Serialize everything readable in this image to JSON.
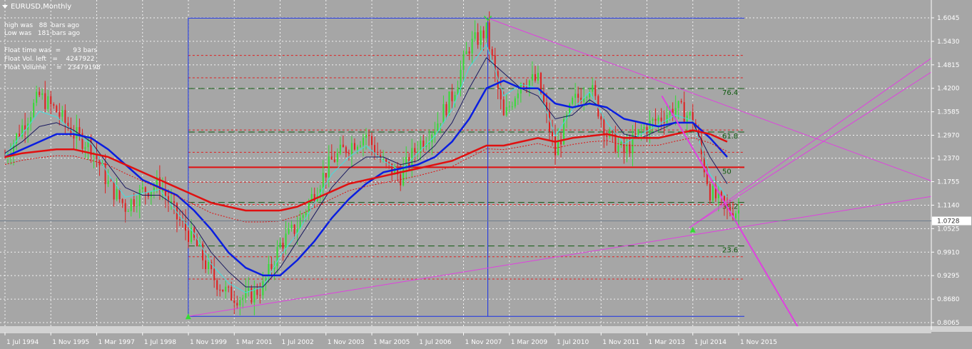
{
  "header": {
    "symbol": "EURUSD,Monthly",
    "info_lines": [
      "high was   88  bars ago",
      "Low was   181 bars ago",
      "",
      "Float time was  =      93 bars",
      "Float Vol. left   =    4247922",
      "Float Volume     =   23479198"
    ]
  },
  "price_axis": {
    "labels": [
      "1.6045",
      "1.5430",
      "1.4815",
      "1.4200",
      "1.3585",
      "1.2970",
      "1.2370",
      "1.1755",
      "1.1140",
      "1.0525",
      "0.9910",
      "0.9295",
      "0.8680",
      "0.8065"
    ],
    "current_price": "1.0728"
  },
  "time_axis": {
    "labels": [
      "1 Jul 1994",
      "1 Nov 1995",
      "1 Mar 1997",
      "1 Jul 1998",
      "1 Nov 1999",
      "1 Mar 2001",
      "1 Jul 2002",
      "1 Nov 2003",
      "1 Mar 2005",
      "1 Jul 2006",
      "1 Nov 2007",
      "1 Mar 2009",
      "1 Jul 2010",
      "1 Nov 2011",
      "1 Mar 2013",
      "1 Jul 2014",
      "1 Nov 2015"
    ]
  },
  "fib_labels": [
    "76.4",
    "61.8",
    "50",
    "38.2",
    "23.6"
  ],
  "colors": {
    "background": "#a6a6a6",
    "bull": "#33dd33",
    "bear": "#e02020",
    "ma_slow": "#e01010",
    "ma_mid": "#0a1ee0",
    "ma_fast": "#1a1a60",
    "ma_cyan": "#40e0e0",
    "fib": "#0f5a0f",
    "box": "#1a32e6",
    "trend": "#e040e0",
    "grid": "#f2f2f2"
  },
  "chart_data": {
    "type": "line",
    "title": "EURUSD,Monthly",
    "xlabel": "",
    "ylabel": "",
    "ylim": [
      0.78,
      1.63
    ],
    "grid": true,
    "x": [
      1994.5,
      1995.0,
      1995.5,
      1996.0,
      1996.5,
      1997.0,
      1997.5,
      1998.0,
      1998.5,
      1999.0,
      1999.5,
      2000.0,
      2000.5,
      2001.0,
      2001.5,
      2002.0,
      2002.5,
      2003.0,
      2003.5,
      2004.0,
      2004.5,
      2005.0,
      2005.5,
      2006.0,
      2006.5,
      2007.0,
      2007.5,
      2008.0,
      2008.5,
      2009.0,
      2009.5,
      2010.0,
      2010.5,
      2011.0,
      2011.5,
      2012.0,
      2012.5,
      2013.0,
      2013.5,
      2014.0,
      2014.5,
      2015.0,
      2015.5
    ],
    "series": [
      {
        "values": [
          1.24,
          1.32,
          1.4,
          1.36,
          1.3,
          1.27,
          1.17,
          1.11,
          1.15,
          1.17,
          1.08,
          1.02,
          0.93,
          0.88,
          0.87,
          0.9,
          1.01,
          1.06,
          1.15,
          1.23,
          1.27,
          1.3,
          1.22,
          1.19,
          1.27,
          1.32,
          1.4,
          1.53,
          1.57,
          1.34,
          1.44,
          1.44,
          1.25,
          1.38,
          1.43,
          1.3,
          1.25,
          1.31,
          1.34,
          1.37,
          1.34,
          1.15,
          1.1
        ]
      },
      {
        "values": [
          1.25,
          1.28,
          1.32,
          1.33,
          1.31,
          1.28,
          1.22,
          1.16,
          1.14,
          1.14,
          1.11,
          1.06,
          0.99,
          0.94,
          0.9,
          0.9,
          0.95,
          1.02,
          1.09,
          1.16,
          1.21,
          1.24,
          1.24,
          1.22,
          1.23,
          1.27,
          1.33,
          1.42,
          1.5,
          1.46,
          1.42,
          1.4,
          1.34,
          1.35,
          1.39,
          1.36,
          1.3,
          1.29,
          1.31,
          1.33,
          1.33,
          1.24,
          1.17
        ]
      },
      {
        "values": [
          1.24,
          1.26,
          1.28,
          1.3,
          1.3,
          1.29,
          1.26,
          1.22,
          1.18,
          1.16,
          1.14,
          1.1,
          1.05,
          0.99,
          0.95,
          0.93,
          0.93,
          0.97,
          1.02,
          1.08,
          1.13,
          1.17,
          1.2,
          1.21,
          1.22,
          1.24,
          1.28,
          1.34,
          1.42,
          1.44,
          1.42,
          1.42,
          1.38,
          1.37,
          1.38,
          1.37,
          1.34,
          1.33,
          1.32,
          1.33,
          1.33,
          1.29,
          1.24
        ]
      },
      {
        "values": [
          1.24,
          1.25,
          1.255,
          1.26,
          1.26,
          1.25,
          1.24,
          1.22,
          1.2,
          1.18,
          1.16,
          1.14,
          1.12,
          1.11,
          1.1,
          1.1,
          1.1,
          1.11,
          1.13,
          1.15,
          1.17,
          1.18,
          1.19,
          1.2,
          1.21,
          1.22,
          1.23,
          1.25,
          1.27,
          1.27,
          1.28,
          1.29,
          1.28,
          1.29,
          1.295,
          1.3,
          1.29,
          1.29,
          1.29,
          1.3,
          1.31,
          1.3,
          1.28
        ]
      }
    ]
  }
}
